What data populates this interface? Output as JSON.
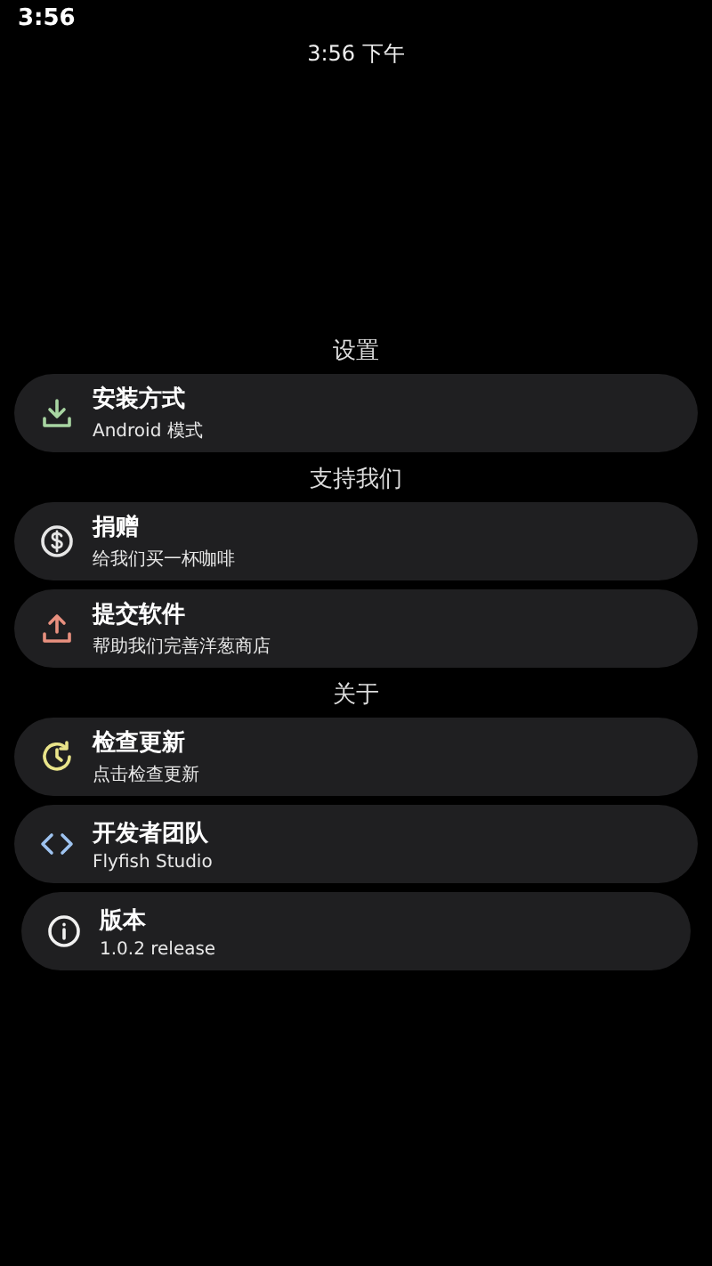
{
  "status_bar": {
    "time": "3:56"
  },
  "clock": "3:56 下午",
  "sections": [
    {
      "title": "设置",
      "items": [
        {
          "kind": "download",
          "color": "#a8d5a2",
          "title": "安装方式",
          "subtitle": "Android 模式"
        }
      ]
    },
    {
      "title": "支持我们",
      "items": [
        {
          "kind": "dollar",
          "color": "#e6e6e6",
          "title": "捐赠",
          "subtitle": "给我们买一杯咖啡"
        },
        {
          "kind": "upload",
          "color": "#e8907f",
          "title": "提交软件",
          "subtitle": "帮助我们完善洋葱商店"
        }
      ]
    },
    {
      "title": "关于",
      "items": [
        {
          "kind": "update",
          "color": "#e9e48a",
          "title": "检查更新",
          "subtitle": "点击检查更新"
        },
        {
          "kind": "code",
          "color": "#9ec3f0",
          "title": "开发者团队",
          "subtitle": "Flyfish Studio"
        },
        {
          "kind": "info",
          "color": "#f0f0f0",
          "title": "版本",
          "subtitle": "1.0.2 release"
        }
      ]
    }
  ]
}
